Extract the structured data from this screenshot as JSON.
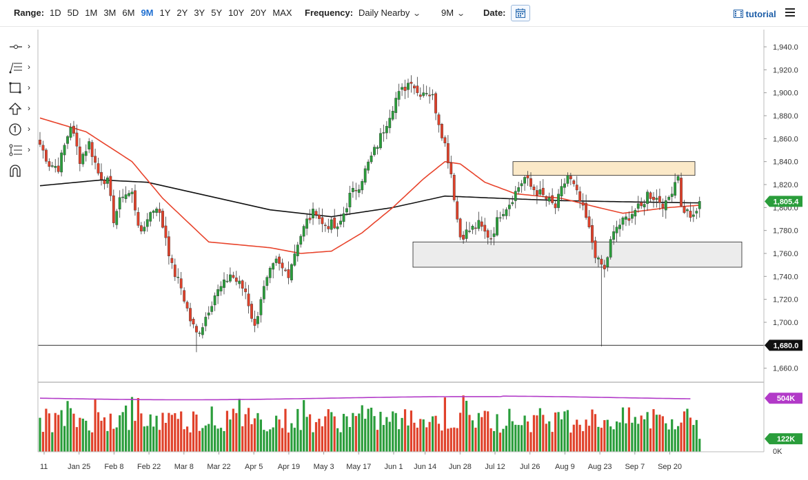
{
  "toolbar": {
    "range_label": "Range:",
    "ranges": [
      "1D",
      "5D",
      "1M",
      "3M",
      "6M",
      "9M",
      "1Y",
      "2Y",
      "3Y",
      "5Y",
      "10Y",
      "20Y",
      "MAX"
    ],
    "active_range": "9M",
    "frequency_label": "Frequency:",
    "frequency_value": "Daily Nearby",
    "period_value": "9M",
    "date_label": "Date:",
    "tutorial_label": "tutorial"
  },
  "sidebar": {
    "tools": [
      "line-tool-icon",
      "fib-tool-icon",
      "rectangle-tool-icon",
      "arrow-up-tool-icon",
      "number-marker-icon",
      "measure-tool-icon",
      "magnet-icon"
    ]
  },
  "colors": {
    "up": "#2a9d3b",
    "down": "#e0412a",
    "ma_short": "#e8432b",
    "ma_long": "#111111",
    "volume_avg": "#b23ac8",
    "price_badge": "#2a9d3b"
  },
  "chart_data": {
    "type": "candlestick",
    "x_tick_labels": [
      "11",
      "Jan 25",
      "Feb 8",
      "Feb 22",
      "Mar 8",
      "Mar 22",
      "Apr 5",
      "Apr 19",
      "May 3",
      "May 17",
      "Jun 1",
      "Jun 14",
      "Jun 28",
      "Jul 12",
      "Jul 26",
      "Aug 9",
      "Aug 23",
      "Sep 7",
      "Sep 20"
    ],
    "y_tick_labels": [
      "1,660.0",
      "1,680.0",
      "1,700.0",
      "1,720.0",
      "1,740.0",
      "1,760.0",
      "1,780.0",
      "1,800.0",
      "1,820.0",
      "1,840.0",
      "1,860.0",
      "1,880.0",
      "1,900.0",
      "1,920.0",
      "1,940.0"
    ],
    "ylim": [
      1652,
      1955
    ],
    "last_price_label": "1,805.4",
    "last_price": 1805.4,
    "support_line_label": "1,680.0",
    "support_line": 1680.0,
    "resistance_zone": [
      1828,
      1840
    ],
    "support_zone": [
      1748,
      1770
    ],
    "close_anchors": [
      [
        0,
        1855
      ],
      [
        3,
        1838
      ],
      [
        6,
        1835
      ],
      [
        10,
        1872
      ],
      [
        13,
        1842
      ],
      [
        16,
        1856
      ],
      [
        19,
        1830
      ],
      [
        22,
        1822
      ],
      [
        24,
        1790
      ],
      [
        27,
        1812
      ],
      [
        30,
        1812
      ],
      [
        33,
        1775
      ],
      [
        35,
        1792
      ],
      [
        38,
        1802
      ],
      [
        41,
        1775
      ],
      [
        43,
        1748
      ],
      [
        46,
        1730
      ],
      [
        49,
        1702
      ],
      [
        51,
        1690
      ],
      [
        53,
        1698
      ],
      [
        55,
        1712
      ],
      [
        57,
        1724
      ],
      [
        60,
        1733
      ],
      [
        62,
        1742
      ],
      [
        64,
        1736
      ],
      [
        67,
        1727
      ],
      [
        70,
        1695
      ],
      [
        72,
        1722
      ],
      [
        75,
        1743
      ],
      [
        77,
        1752
      ],
      [
        79,
        1746
      ],
      [
        81,
        1743
      ],
      [
        84,
        1770
      ],
      [
        87,
        1788
      ],
      [
        90,
        1798
      ],
      [
        92,
        1785
      ],
      [
        95,
        1785
      ],
      [
        97,
        1780
      ],
      [
        99,
        1795
      ],
      [
        101,
        1810
      ],
      [
        104,
        1820
      ],
      [
        107,
        1838
      ],
      [
        110,
        1855
      ],
      [
        113,
        1875
      ],
      [
        116,
        1895
      ],
      [
        119,
        1905
      ],
      [
        121,
        1912
      ],
      [
        123,
        1900
      ],
      [
        126,
        1902
      ],
      [
        128,
        1896
      ],
      [
        130,
        1875
      ],
      [
        132,
        1855
      ],
      [
        134,
        1830
      ],
      [
        136,
        1790
      ],
      [
        137,
        1775
      ],
      [
        140,
        1780
      ],
      [
        143,
        1785
      ],
      [
        145,
        1778
      ],
      [
        147,
        1774
      ],
      [
        150,
        1795
      ],
      [
        153,
        1804
      ],
      [
        156,
        1818
      ],
      [
        158,
        1826
      ],
      [
        160,
        1818
      ],
      [
        163,
        1812
      ],
      [
        166,
        1805
      ],
      [
        168,
        1800
      ],
      [
        170,
        1815
      ],
      [
        172,
        1828
      ],
      [
        174,
        1818
      ],
      [
        176,
        1805
      ],
      [
        178,
        1790
      ],
      [
        179,
        1780
      ],
      [
        181,
        1760
      ],
      [
        182,
        1752
      ],
      [
        183,
        1750
      ],
      [
        184,
        1745
      ],
      [
        186,
        1770
      ],
      [
        188,
        1783
      ],
      [
        191,
        1790
      ],
      [
        194,
        1798
      ],
      [
        196,
        1800
      ],
      [
        198,
        1812
      ],
      [
        201,
        1808
      ],
      [
        204,
        1802
      ],
      [
        206,
        1816
      ],
      [
        208,
        1830
      ],
      [
        209,
        1800
      ],
      [
        211,
        1796
      ],
      [
        213,
        1790
      ],
      [
        214,
        1796
      ],
      [
        215,
        1805
      ]
    ],
    "ma_short": [
      [
        0,
        1878
      ],
      [
        15,
        1866
      ],
      [
        30,
        1840
      ],
      [
        40,
        1808
      ],
      [
        55,
        1770
      ],
      [
        75,
        1765
      ],
      [
        85,
        1760
      ],
      [
        95,
        1762
      ],
      [
        105,
        1778
      ],
      [
        115,
        1800
      ],
      [
        125,
        1825
      ],
      [
        132,
        1840
      ],
      [
        137,
        1838
      ],
      [
        145,
        1822
      ],
      [
        155,
        1812
      ],
      [
        170,
        1808
      ],
      [
        182,
        1800
      ],
      [
        190,
        1795
      ],
      [
        205,
        1800
      ],
      [
        215,
        1802
      ]
    ],
    "ma_long": [
      [
        0,
        1819
      ],
      [
        20,
        1824
      ],
      [
        35,
        1822
      ],
      [
        55,
        1810
      ],
      [
        75,
        1798
      ],
      [
        95,
        1792
      ],
      [
        115,
        1800
      ],
      [
        132,
        1810
      ],
      [
        150,
        1808
      ],
      [
        170,
        1806
      ],
      [
        190,
        1805
      ],
      [
        215,
        1804
      ]
    ],
    "volume": {
      "max_label": "504K",
      "last_label": "122K",
      "zero_label": "0K",
      "avg_level": 504,
      "last_value": 122,
      "ylim": [
        0,
        570
      ]
    }
  }
}
